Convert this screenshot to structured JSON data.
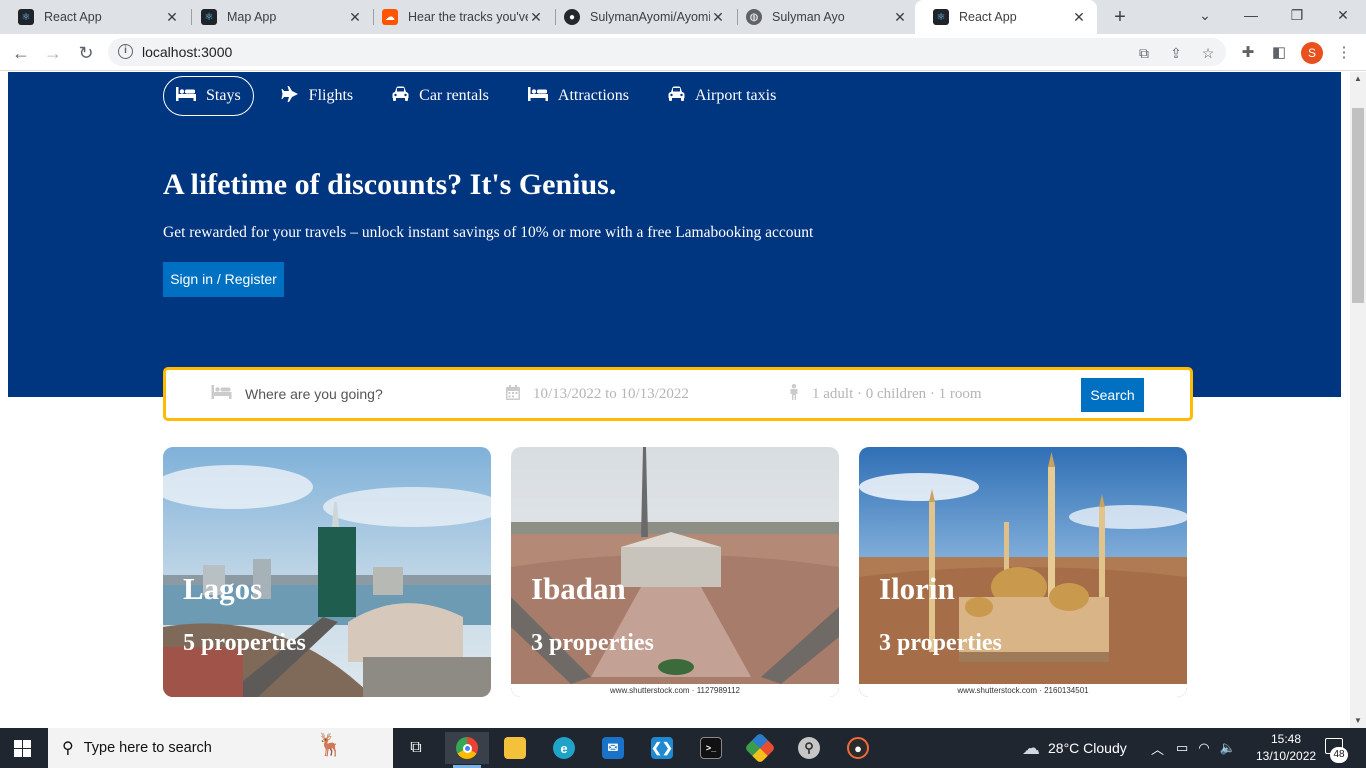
{
  "browser": {
    "tabs": [
      {
        "title": "React App",
        "icon": "react-icon",
        "active": false
      },
      {
        "title": "Map App",
        "icon": "react-icon",
        "active": false
      },
      {
        "title": "Hear the tracks you've",
        "icon": "soundcloud-icon",
        "active": false
      },
      {
        "title": "SulymanAyomi/Ayomi",
        "icon": "github-icon",
        "active": false
      },
      {
        "title": "Sulyman Ayo",
        "icon": "globe-icon",
        "active": false
      },
      {
        "title": "React App",
        "icon": "react-icon",
        "active": true
      }
    ],
    "url": "localhost:3000",
    "profile_initial": "S"
  },
  "header": {
    "nav": [
      {
        "label": "Stays",
        "icon": "bed-icon",
        "active": true
      },
      {
        "label": "Flights",
        "icon": "plane-icon",
        "active": false
      },
      {
        "label": "Car rentals",
        "icon": "car-icon",
        "active": false
      },
      {
        "label": "Attractions",
        "icon": "bed-icon",
        "active": false
      },
      {
        "label": "Airport taxis",
        "icon": "taxi-icon",
        "active": false
      }
    ],
    "title": "A lifetime of discounts? It's Genius.",
    "description": "Get rewarded for your travels – unlock instant savings of 10% or more with a free Lamabooking account",
    "signin_label": "Sign in / Register"
  },
  "search": {
    "destination_placeholder": "Where are you going?",
    "dates": "10/13/2022 to 10/13/2022",
    "options": "1 adult · 0 children · 1 room",
    "button_label": "Search"
  },
  "featured": [
    {
      "city": "Lagos",
      "properties": "5 properties",
      "credit": ""
    },
    {
      "city": "Ibadan",
      "properties": "3 properties",
      "credit": "www.shutterstock.com · 1127989112"
    },
    {
      "city": "Ilorin",
      "properties": "3 properties",
      "credit": "www.shutterstock.com · 2160134501"
    }
  ],
  "taskbar": {
    "search_placeholder": "Type here to search",
    "weather": "28°C  Cloudy",
    "time": "15:48",
    "date": "13/10/2022",
    "notifications": "48"
  },
  "colors": {
    "brand": "#003580",
    "button": "#0071c2",
    "search_border": "#febb02"
  }
}
